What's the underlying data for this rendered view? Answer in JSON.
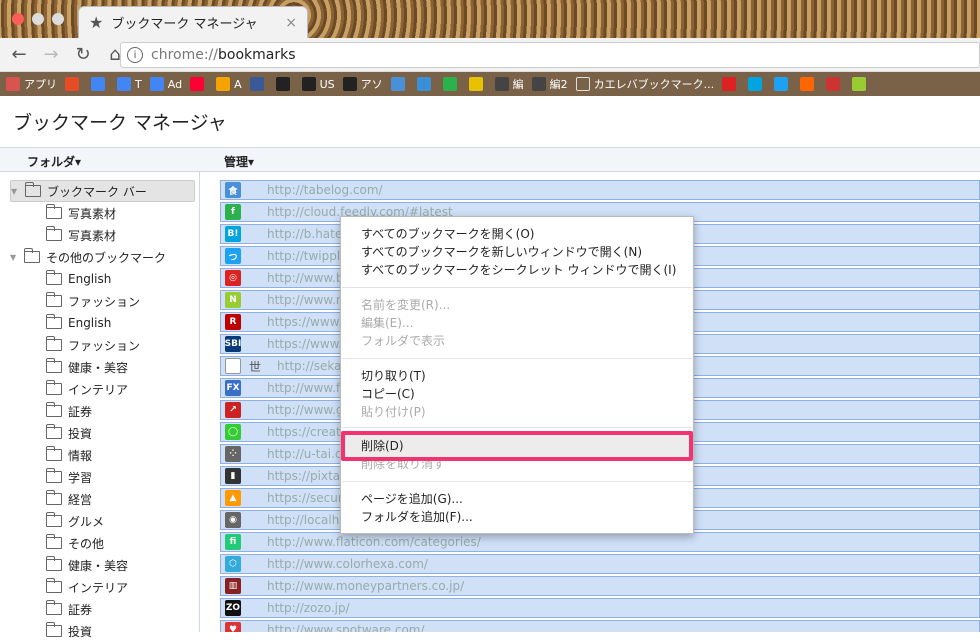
{
  "window": {
    "tab_title": "ブックマーク マネージャ",
    "tab_close": "×"
  },
  "toolbar": {
    "url_scheme": "chrome://",
    "url_path": "bookmarks"
  },
  "bookmarks_bar": [
    {
      "label": "アプリ",
      "icon": "apps-grid-icon",
      "color": "#d9534f"
    },
    {
      "label": "",
      "icon": "e-icon",
      "color": "#e54d26"
    },
    {
      "label": "",
      "icon": "google-icon",
      "color": "#4285f4"
    },
    {
      "label": "T",
      "icon": "google-icon",
      "color": "#4285f4"
    },
    {
      "label": "Ad",
      "icon": "google-icon",
      "color": "#4285f4"
    },
    {
      "label": "",
      "icon": "yahoo-icon",
      "color": "#ff0033"
    },
    {
      "label": "A",
      "icon": "bar-chart-icon",
      "color": "#f4a300"
    },
    {
      "label": "",
      "icon": "facebook-icon",
      "color": "#3b5998"
    },
    {
      "label": "",
      "icon": "amazon-icon",
      "color": "#222"
    },
    {
      "label": "US",
      "icon": "amazon-icon",
      "color": "#222"
    },
    {
      "label": "アソ",
      "icon": "amazon-icon",
      "color": "#222"
    },
    {
      "label": "",
      "icon": "tabelog-icon",
      "color": "#4a90d9"
    },
    {
      "label": "",
      "icon": "cj-icon",
      "color": "#3a8fd6"
    },
    {
      "label": "",
      "icon": "feedly-icon",
      "color": "#2bb24c"
    },
    {
      "label": "",
      "icon": "j-icon",
      "color": "#e8c200"
    },
    {
      "label": "編",
      "icon": "info-icon",
      "color": "#444"
    },
    {
      "label": "編2",
      "icon": "info-icon",
      "color": "#444"
    },
    {
      "label": "カエレバブックマーク...",
      "icon": "doc-icon",
      "color": "#fff"
    },
    {
      "label": "",
      "icon": "a8-icon",
      "color": "#d22"
    },
    {
      "label": "",
      "icon": "hatena-icon",
      "color": "#00a4de"
    },
    {
      "label": "",
      "icon": "twipple-icon",
      "color": "#1da1f2"
    },
    {
      "label": "",
      "icon": "orange-icon",
      "color": "#f60"
    },
    {
      "label": "",
      "icon": "red-icon",
      "color": "#c33"
    },
    {
      "label": "",
      "icon": "n-icon",
      "color": "#9c3"
    }
  ],
  "page_title": "ブックマーク マネージャ",
  "columns": {
    "folder": "フォルダ▾",
    "manage": "管理▾"
  },
  "folders": [
    {
      "label": "ブックマーク バー",
      "level": 0,
      "expanded": true,
      "selected": true
    },
    {
      "label": "写真素材",
      "level": 1
    },
    {
      "label": "写真素材",
      "level": 1
    },
    {
      "label": "その他のブックマーク",
      "level": 0,
      "expanded": true
    },
    {
      "label": "English",
      "level": 1
    },
    {
      "label": "ファッション",
      "level": 1
    },
    {
      "label": "English",
      "level": 1
    },
    {
      "label": "ファッション",
      "level": 1
    },
    {
      "label": "健康・美容",
      "level": 1
    },
    {
      "label": "インテリア",
      "level": 1
    },
    {
      "label": "証券",
      "level": 1
    },
    {
      "label": "投資",
      "level": 1
    },
    {
      "label": "情報",
      "level": 1
    },
    {
      "label": "学習",
      "level": 1
    },
    {
      "label": "経営",
      "level": 1
    },
    {
      "label": "グルメ",
      "level": 1
    },
    {
      "label": "その他",
      "level": 1
    },
    {
      "label": "健康・美容",
      "level": 1
    },
    {
      "label": "インテリア",
      "level": 1
    },
    {
      "label": "証券",
      "level": 1
    },
    {
      "label": "投資",
      "level": 1
    }
  ],
  "bookmarks": [
    {
      "url": "http://tabelog.com/",
      "icon": "tabelog-icon",
      "color": "#4a90d9",
      "glyph": "食"
    },
    {
      "url": "http://cloud.feedly.com/#latest",
      "icon": "feedly-icon",
      "color": "#2bb24c",
      "glyph": "f"
    },
    {
      "url": "http://b.hatena",
      "icon": "hatena-icon",
      "color": "#00a4de",
      "glyph": "B!"
    },
    {
      "url": "http://twipple.j",
      "icon": "twipple-icon",
      "color": "#1da1f2",
      "glyph": "つ"
    },
    {
      "url": "http://www.bk",
      "icon": "hmv-icon",
      "color": "#d22",
      "glyph": "◎"
    },
    {
      "url": "http://www.ne",
      "icon": "n-icon",
      "color": "#9c3",
      "glyph": "N"
    },
    {
      "url": "https://www.ra",
      "icon": "rakuten-icon",
      "color": "#bf0000",
      "glyph": "R"
    },
    {
      "url": "https://www.sb",
      "icon": "sbi-icon",
      "color": "#0a3a7a",
      "glyph": "SBI"
    },
    {
      "url": "http://sekai-",
      "icon": "doc-icon",
      "color": "#fff",
      "glyph": "",
      "name": "世"
    },
    {
      "url": "http://www.fxo",
      "icon": "fx-icon",
      "color": "#3a6fc7",
      "glyph": "FX"
    },
    {
      "url": "http://www.ga",
      "icon": "arrow-icon",
      "color": "#c22",
      "glyph": "↗"
    },
    {
      "url": "https://creator",
      "icon": "line-icon",
      "color": "#3c3",
      "glyph": "◯"
    },
    {
      "url": "http://u-tai.co",
      "icon": "dots-icon",
      "color": "#666",
      "glyph": "⁘"
    },
    {
      "url": "https://pixta.jp",
      "icon": "pixta-icon",
      "color": "#333",
      "glyph": "▮"
    },
    {
      "url": "https://secure",
      "icon": "pma-icon",
      "color": "#f90",
      "glyph": "▲"
    },
    {
      "url": "http://localhos",
      "icon": "wordpress-icon",
      "color": "#666",
      "glyph": "◉"
    },
    {
      "url": "http://www.flaticon.com/categories/",
      "icon": "flaticon-icon",
      "color": "#2c7",
      "glyph": "fi"
    },
    {
      "url": "http://www.colorhexa.com/",
      "icon": "colorhexa-icon",
      "color": "#3ad",
      "glyph": "⬡"
    },
    {
      "url": "http://www.moneypartners.co.jp/",
      "icon": "moneypartners-icon",
      "color": "#822",
      "glyph": "▥"
    },
    {
      "url": "http://zozo.jp/",
      "icon": "zozo-icon",
      "color": "#111",
      "glyph": "ZO"
    },
    {
      "url": "http://www.spotware.com/",
      "icon": "spotware-icon",
      "color": "#d33",
      "glyph": "♥"
    }
  ],
  "context_menu": {
    "open_all": "すべてのブックマークを開く(O)",
    "open_all_new_window": "すべてのブックマークを新しいウィンドウで開く(N)",
    "open_all_incognito": "すべてのブックマークをシークレット ウィンドウで開く(I)",
    "rename": "名前を変更(R)...",
    "edit": "編集(E)...",
    "show_in_folder": "フォルダで表示",
    "cut": "切り取り(T)",
    "copy": "コピー(C)",
    "paste": "貼り付け(P)",
    "delete": "削除(D)",
    "undo_delete": "削除を取り消す",
    "add_page": "ページを追加(G)...",
    "add_folder": "フォルダを追加(F)..."
  }
}
